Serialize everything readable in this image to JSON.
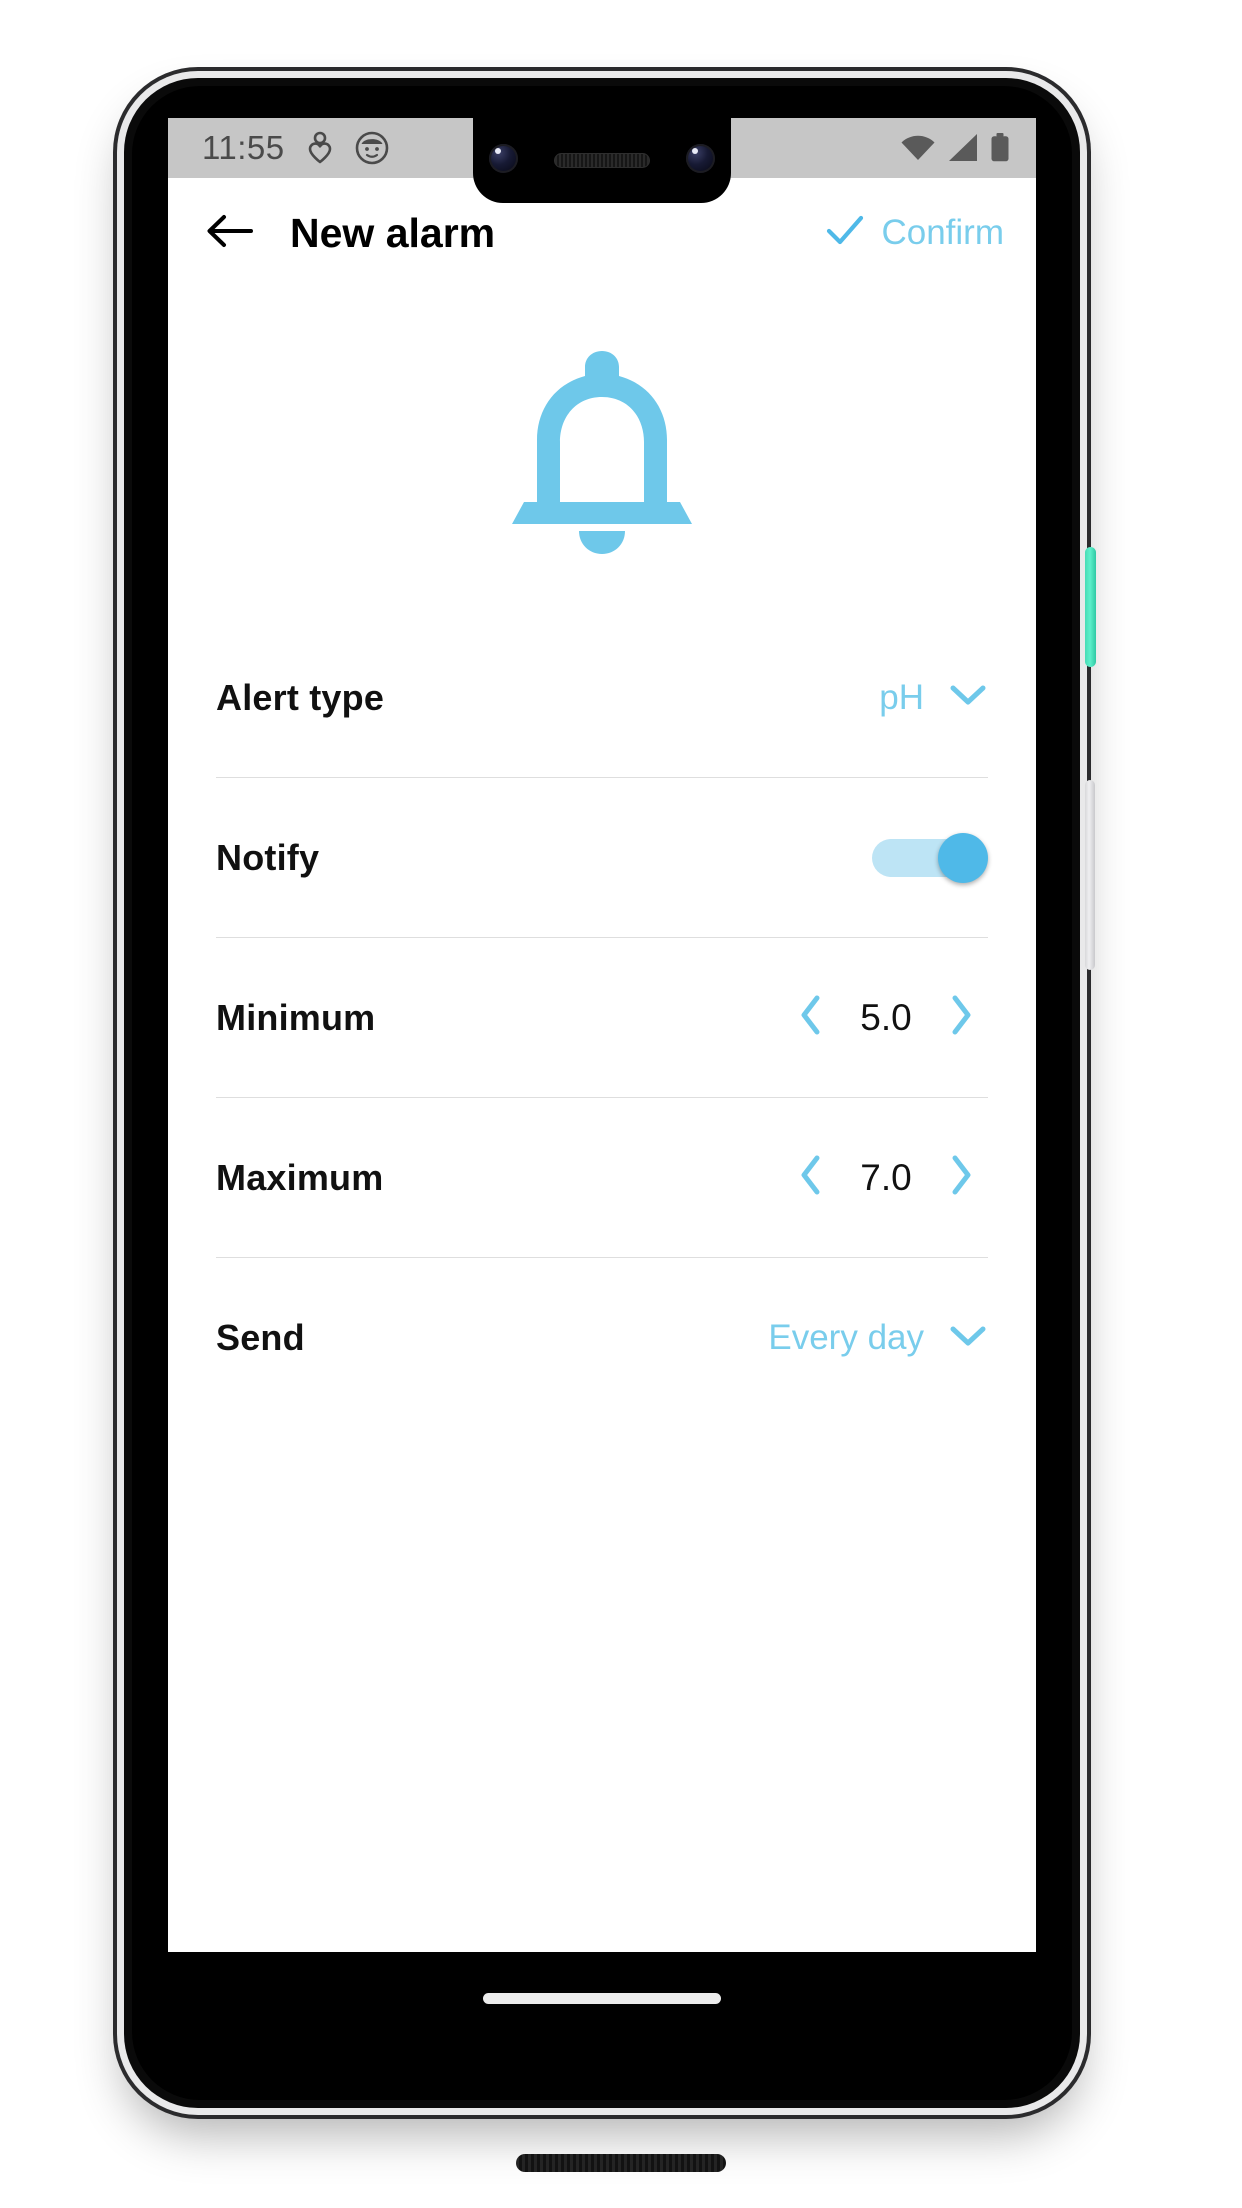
{
  "colors": {
    "accent": "#79cdec",
    "accent_strong": "#4fb9e8",
    "toggle_track": "#bde4f5",
    "status_bar_bg": "#c6c6c6",
    "text_primary": "#111111",
    "divider": "#dedede",
    "power_button": "#4fdcb8"
  },
  "status_bar": {
    "time": "11:55",
    "notification_icons": [
      "heart-outline-icon",
      "avatar-face-icon"
    ],
    "system_icons": [
      "wifi-icon",
      "cellular-signal-icon",
      "battery-icon"
    ]
  },
  "app_bar": {
    "back_icon": "arrow-left-icon",
    "title": "New alarm",
    "confirm_icon": "check-icon",
    "confirm_label": "Confirm"
  },
  "hero": {
    "icon": "bell-icon"
  },
  "settings": {
    "rows": [
      {
        "label": "Alert type",
        "control": "dropdown",
        "value": "pH",
        "icon": "chevron-down-icon"
      },
      {
        "label": "Notify",
        "control": "toggle",
        "value": "on"
      },
      {
        "label": "Minimum",
        "control": "stepper",
        "value": "5.0",
        "decrement_icon": "chevron-left-icon",
        "increment_icon": "chevron-right-icon"
      },
      {
        "label": "Maximum",
        "control": "stepper",
        "value": "7.0",
        "decrement_icon": "chevron-left-icon",
        "increment_icon": "chevron-right-icon"
      },
      {
        "label": "Send",
        "control": "dropdown",
        "value": "Every day",
        "icon": "chevron-down-icon"
      }
    ]
  },
  "navigation": {
    "gesture_pill": "home-gesture-pill"
  }
}
